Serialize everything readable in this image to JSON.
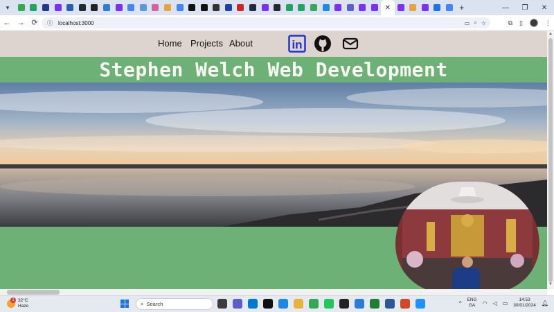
{
  "browser": {
    "tab_favicon_colors": [
      "#34a853",
      "#1fa463",
      "#1e3a8a",
      "#7b2ff7",
      "#2a5db0",
      "#24292f",
      "#222222",
      "#2b7bd9",
      "#7b2ff7",
      "#4285f4",
      "#5b9bd5",
      "#d85fa0",
      "#e8a33d",
      "#4285f4",
      "#111111",
      "#111111",
      "#333333",
      "#1e40af",
      "#c62828",
      "#1f2a44",
      "#7b2ff7",
      "#24292f",
      "#1fa463",
      "#1fa463",
      "#34a853",
      "#1e88e5",
      "#7b2ff7",
      "#5b5fc7",
      "#7b2ff7",
      "#7b2ff7",
      "#e53935",
      "#7b2ff7",
      "#e8a33d",
      "#7b2ff7",
      "#1a73e8",
      "#4285f4"
    ],
    "active_tab_close": "✕",
    "new_tab": "+",
    "window_minimize": "—",
    "window_restore": "❐",
    "window_close": "✕",
    "nav_back": "←",
    "nav_forward": "→",
    "nav_reload": "⟳",
    "url_info": "ⓘ",
    "url": "localhost:3000"
  },
  "site": {
    "nav": {
      "home": "Home",
      "projects": "Projects",
      "about": "About"
    },
    "social_icons": [
      "linkedin-icon",
      "github-icon",
      "mail-icon"
    ],
    "linkedin_text": "in",
    "title": "Stephen Welch Web Development",
    "colors": {
      "nav_bg": "#ddd4d0",
      "green": "#6db177",
      "linkedin_blue": "#1b33d6"
    }
  },
  "taskbar": {
    "weather_temp": "32°C",
    "weather_desc": "Haze",
    "weather_badge": "1",
    "search_placeholder": "Search",
    "lang_line1": "ENG",
    "lang_line2": "GA",
    "time": "14:53",
    "date": "30/01/2024",
    "app_colors": [
      "#3c3c3c",
      "#5b5fc7",
      "#0078d4",
      "#111111",
      "#1e88e5",
      "#e8b33d",
      "#34a853",
      "#22c55e",
      "#222222",
      "#2b7bd9",
      "#1e7e34",
      "#2b5797",
      "#d24726",
      "#1e90ff"
    ]
  }
}
